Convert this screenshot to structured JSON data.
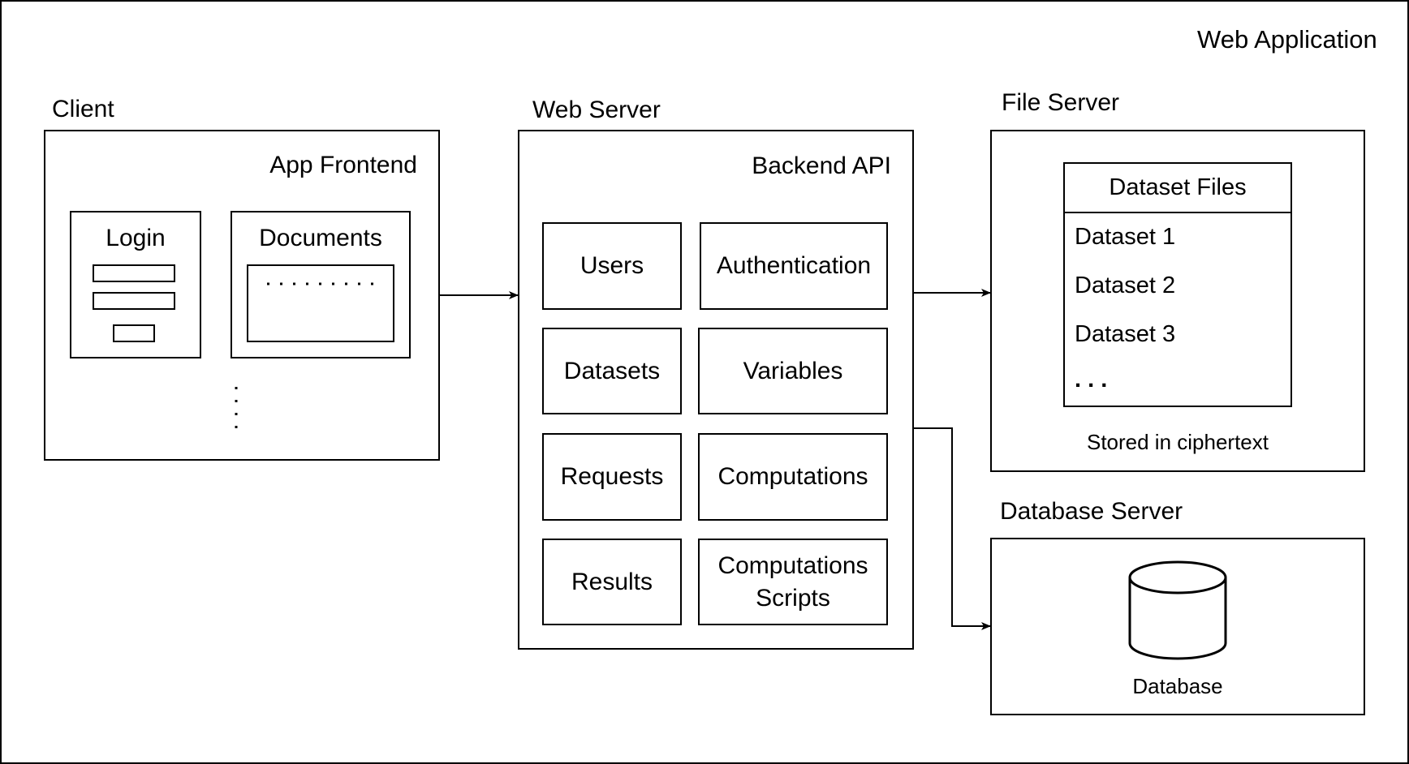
{
  "diagram": {
    "title": "Web Application",
    "client": {
      "label": "Client",
      "container_label": "App Frontend",
      "components": [
        {
          "label": "Login",
          "icon": "login-form-icon"
        },
        {
          "label": "Documents",
          "icon": "document-list-icon"
        }
      ],
      "more_indicator": "vertical-ellipsis-icon"
    },
    "web_server": {
      "label": "Web Server",
      "container_label": "Backend API",
      "modules": [
        "Users",
        "Authentication",
        "Datasets",
        "Variables",
        "Requests",
        "Computations",
        "Results",
        "Computations Scripts"
      ]
    },
    "file_server": {
      "label": "File Server",
      "list_title": "Dataset Files",
      "items": [
        "Dataset 1",
        "Dataset 2",
        "Dataset 3",
        ". . ."
      ],
      "note": "Stored in ciphertext"
    },
    "database_server": {
      "label": "Database Server",
      "store_label": "Database",
      "icon": "database-cylinder-icon"
    },
    "connections": [
      {
        "from": "Client",
        "to": "Web Server"
      },
      {
        "from": "Web Server",
        "to": "File Server"
      },
      {
        "from": "Web Server",
        "to": "Database Server"
      }
    ]
  }
}
